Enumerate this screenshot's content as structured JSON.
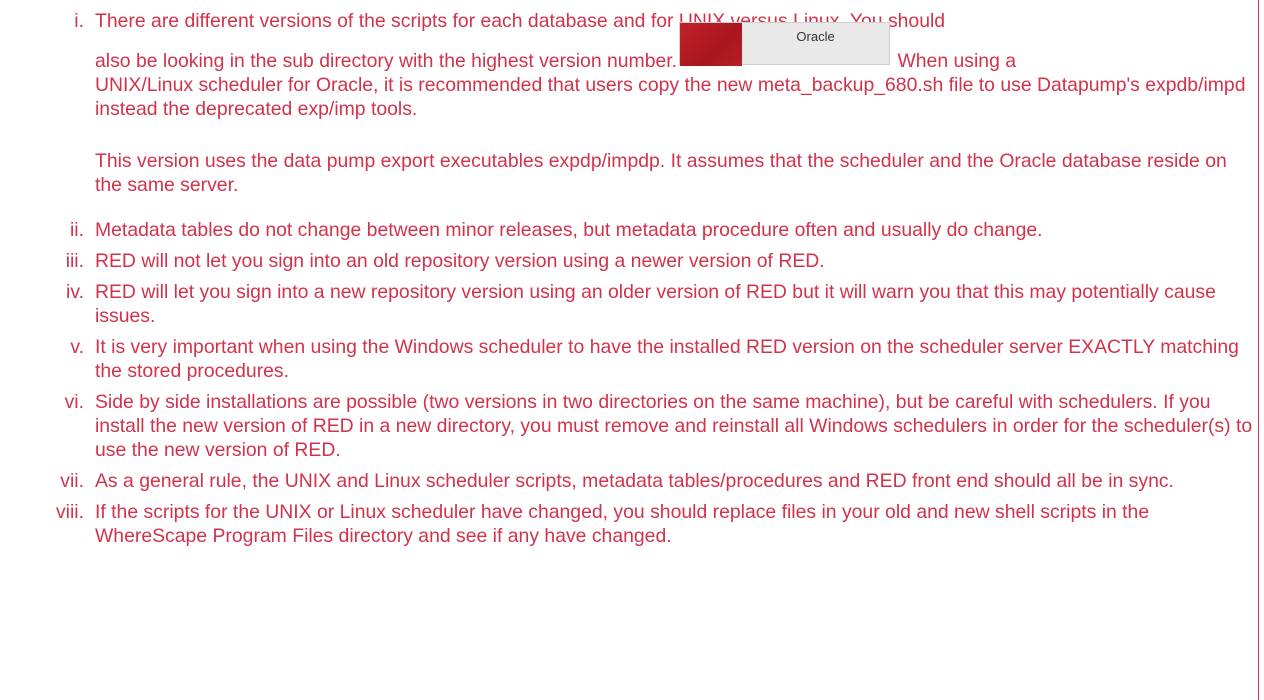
{
  "items": [
    {
      "num": "i.",
      "line1": "There are different versions of the scripts for each database and for UNIX versus Linux. You should",
      "line2_before": "also be looking in the sub directory with the highest version number.",
      "button_label": "Oracle",
      "line2_after": " When using a",
      "rest": "UNIX/Linux scheduler for Oracle, it is recommended that users copy the new meta_backup_680.sh file to use Datapump's expdb/impd instead the deprecated exp/imp tools.",
      "para2": "This version uses the data pump export executables expdp/impdp. It assumes that the scheduler and the Oracle database reside on the same server."
    },
    {
      "num": "ii.",
      "text": "Metadata tables do not change between minor releases, but metadata procedure often and usually do change."
    },
    {
      "num": "iii.",
      "text": "RED will not let you sign into an old repository version using a newer version of RED."
    },
    {
      "num": "iv.",
      "text": "RED will let you sign into a new repository version using an older version of RED but it will warn you that this may potentially cause issues."
    },
    {
      "num": "v.",
      "text": "It is very important when using the Windows scheduler to have the installed RED version on the scheduler server EXACTLY matching the stored procedures."
    },
    {
      "num": "vi.",
      "text": "Side by side installations are possible (two versions in two directories on the same machine), but be careful with schedulers. If you install the new version of RED in a new directory, you must remove and reinstall all Windows schedulers in order for the scheduler(s) to use the new version of RED."
    },
    {
      "num": "vii.",
      "text": "As a general rule, the UNIX and Linux scheduler scripts, metadata tables/procedures and RED front end should all be in sync."
    },
    {
      "num": "viii.",
      "text": "If the scripts for the UNIX or Linux scheduler have changed, you should replace files in your old and new shell scripts in the WhereScape Program Files directory and see if any have changed."
    }
  ],
  "colors": {
    "text": "#d2334c",
    "button_swatch": "#b81e25",
    "button_bg": "#e9e9e9"
  }
}
